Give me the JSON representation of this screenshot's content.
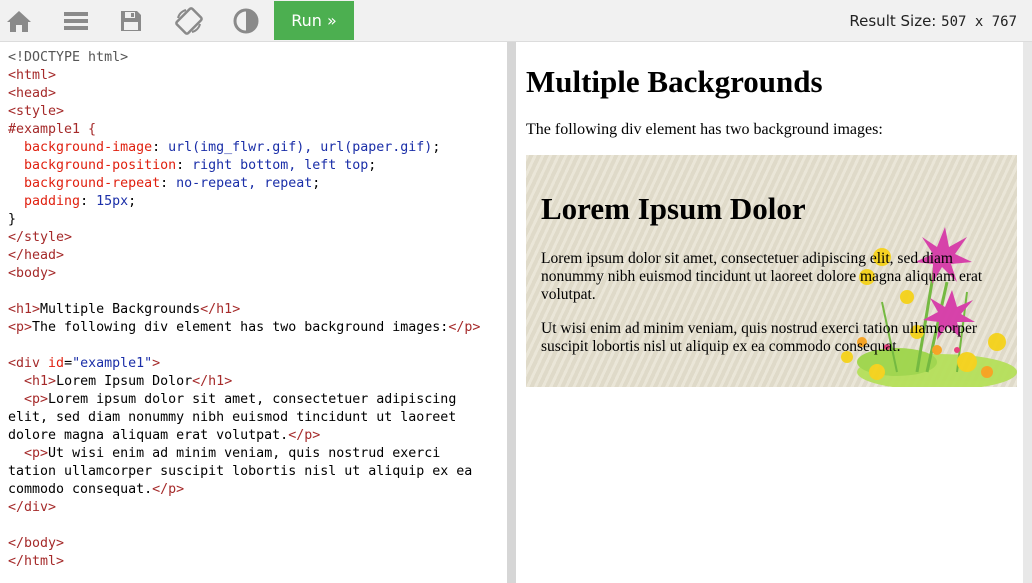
{
  "toolbar": {
    "icons": [
      "home-icon",
      "menu-icon",
      "save-icon",
      "rotate-icon",
      "contrast-icon"
    ],
    "run_label": "Run »",
    "result_size_label": "Result Size:",
    "result_size_value": "507 x 767"
  },
  "code": {
    "lines": [
      "<!DOCTYPE html>",
      "<html>",
      "<head>",
      "<style>",
      "#example1 {",
      "  background-image: url(img_flwr.gif), url(paper.gif);",
      "  background-position: right bottom, left top;",
      "  background-repeat: no-repeat, repeat;",
      "  padding: 15px;",
      "}",
      "</style>",
      "</head>",
      "<body>",
      "",
      "<h1>Multiple Backgrounds</h1>",
      "<p>The following div element has two background images:</p>",
      "",
      "<div id=\"example1\">",
      "  <h1>Lorem Ipsum Dolor</h1>",
      "  <p>Lorem ipsum dolor sit amet, consectetuer adipiscing",
      "elit, sed diam nonummy nibh euismod tincidunt ut laoreet",
      "dolore magna aliquam erat volutpat.</p>",
      "  <p>Ut wisi enim ad minim veniam, quis nostrud exerci",
      "tation ullamcorper suscipit lobortis nisl ut aliquip ex ea",
      "commodo consequat.</p>",
      "</div>",
      "",
      "</body>",
      "</html>"
    ]
  },
  "result": {
    "heading": "Multiple Backgrounds",
    "intro": "The following div element has two background images:",
    "box_heading": "Lorem Ipsum Dolor",
    "box_p1": "Lorem ipsum dolor sit amet, consectetuer adipiscing elit, sed diam nonummy nibh euismod tincidunt ut laoreet dolore magna aliquam erat volutpat.",
    "box_p2": "Ut wisi enim ad minim veniam, quis nostrud exerci tation ullamcorper suscipit lobortis nisl ut aliquip ex ea commodo consequat."
  },
  "colors": {
    "run_button": "#4caf50",
    "toolbar_bg": "#f1f1f1",
    "tag": "#a52a2a",
    "property": "#e0200f",
    "value": "#1a2ea8"
  }
}
